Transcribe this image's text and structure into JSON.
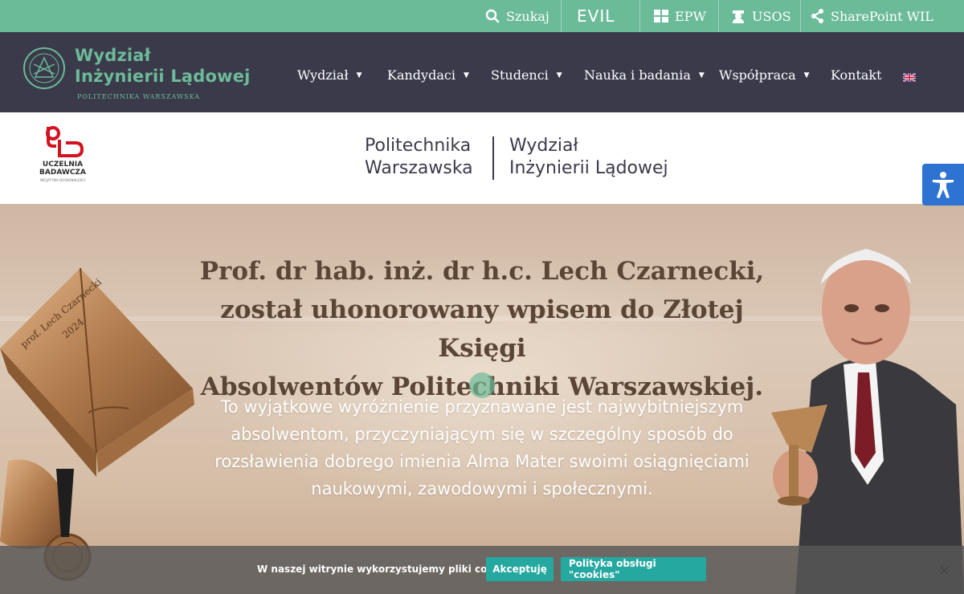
{
  "colors": {
    "accent_green": "#6cbb98",
    "nav_bg": "#3b3a4b",
    "button_teal": "#25a8a0",
    "a11y_blue": "#2e72d2"
  },
  "topbar": {
    "search_label": "Szukaj",
    "evil_label": "EVIL",
    "epw_label": "EPW",
    "usos_label": "USOS",
    "sharepoint_label": "SharePoint WIL"
  },
  "header": {
    "logo_title_line1": "Wydział",
    "logo_title_line2": "Inżynierii Lądowej",
    "logo_subtitle": "POLITECHNIKA WARSZAWSKA",
    "nav": [
      {
        "label": "Wydział"
      },
      {
        "label": "Kandydaci"
      },
      {
        "label": "Studenci"
      },
      {
        "label": "Nauka i badania"
      },
      {
        "label": "Współpraca"
      },
      {
        "label": "Kontakt"
      }
    ],
    "language_icon": "uk-flag-icon"
  },
  "brand": {
    "ub_line1": "UCZELNIA",
    "ub_line2": "BADAWCZA",
    "ub_small": "INICJATYWA DOSKONAŁOŚCI",
    "pw_line1": "Politechnika",
    "pw_line2": "Warszawska",
    "wil_line1": "Wydział",
    "wil_line2": "Inżynierii Lądowej"
  },
  "hero": {
    "title_line1": "Prof. dr hab. inż. dr h.c. Lech Czarnecki,",
    "title_line2": "został uhonorowany wpisem do Złotej Księgi",
    "title_line3": "Absolwentów Politechniki Warszawskiej.",
    "body_line1": "To wyjątkowe wyróżnienie przyznawane jest najwybitniejszym",
    "body_line2": "absolwentom, przyczyniającym się w szczególny sposób do",
    "body_line3": "rozsławienia dobrego imienia Alma Mater swoimi osiągnięciami",
    "body_line4": "naukowymi, zawodowymi i społecznymi.",
    "book_inscription": "prof. Lech Czarnecki",
    "book_year": "2024"
  },
  "cookie": {
    "text": "W naszej witrynie wykorzystujemy pliki cookies.",
    "accept_label": "Akceptuję",
    "policy_label": "Polityka obsługi \"cookies\"",
    "close_label": "×"
  }
}
